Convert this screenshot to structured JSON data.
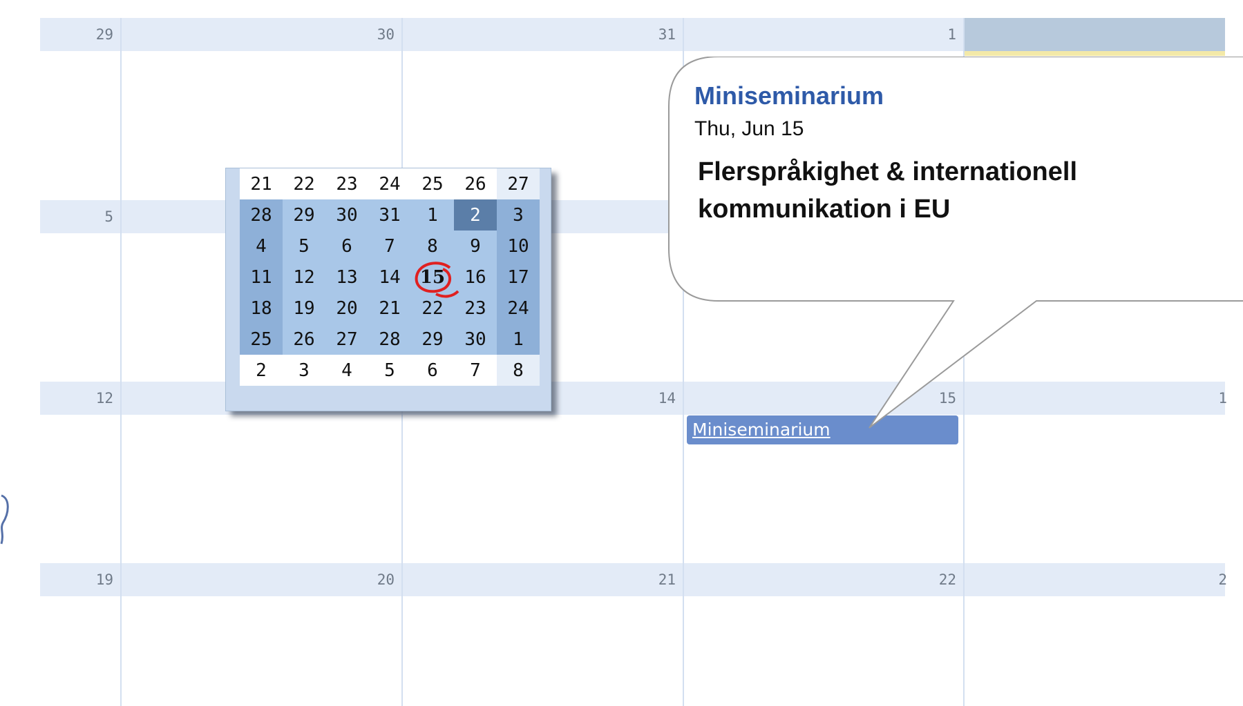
{
  "calendar": {
    "weeks": [
      {
        "days": [
          "29",
          "30",
          "31",
          "1",
          ""
        ]
      },
      {
        "days": [
          "5",
          "",
          "",
          "",
          ""
        ]
      },
      {
        "days": [
          "12",
          "",
          "14",
          "15",
          "1"
        ]
      },
      {
        "days": [
          "19",
          "20",
          "21",
          "22",
          "2"
        ]
      }
    ]
  },
  "event": {
    "chip_label": "Miniseminarium",
    "popup": {
      "title": "Miniseminarium",
      "date": "Thu, Jun 15",
      "description": "Flerspråkighet & internationell kommunikation i EU"
    }
  },
  "mini_calendar": {
    "rows": [
      [
        "21",
        "22",
        "23",
        "24",
        "25",
        "26",
        "27"
      ],
      [
        "28",
        "29",
        "30",
        "31",
        "1",
        "2",
        "3"
      ],
      [
        "4",
        "5",
        "6",
        "7",
        "8",
        "9",
        "10"
      ],
      [
        "11",
        "12",
        "13",
        "14",
        "15",
        "16",
        "17"
      ],
      [
        "18",
        "19",
        "20",
        "21",
        "22",
        "23",
        "24"
      ],
      [
        "25",
        "26",
        "27",
        "28",
        "29",
        "30",
        "1"
      ],
      [
        "2",
        "3",
        "4",
        "5",
        "6",
        "7",
        "8"
      ]
    ]
  },
  "colors": {
    "header_band": "#e3ebf7",
    "selected_header": "#b7c9dc",
    "event_chip": "#6a8dcc",
    "popup_title": "#2e5aa8",
    "today_circle": "#e02020"
  }
}
